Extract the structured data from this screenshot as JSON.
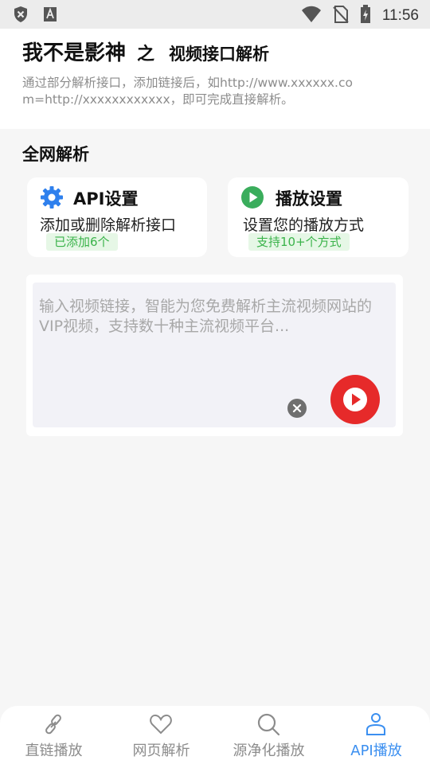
{
  "status_bar": {
    "time": "11:56",
    "icons": [
      "shield-x-icon",
      "font-a-icon",
      "wifi-icon",
      "no-sim-icon",
      "battery-charging-icon"
    ]
  },
  "header": {
    "title": "我不是影神",
    "connector": "之",
    "subtitle": "视频接口解析",
    "description": "通过部分解析接口，添加链接后，如http://www.xxxxxx.com=http://xxxxxxxxxxxx，即可完成直接解析。"
  },
  "section": {
    "title": "全网解析"
  },
  "cards": {
    "api": {
      "icon": "gear-icon",
      "title": "API设置",
      "description": "添加或删除解析接口",
      "badge": "已添加6个",
      "icon_color": "#2f80ed"
    },
    "play": {
      "icon": "play-circle-icon",
      "title": "播放设置",
      "description": "设置您的播放方式",
      "badge": "支持10+个方式",
      "icon_color": "#3aad5c"
    }
  },
  "input": {
    "placeholder": "输入视频链接，智能为您免费解析主流视频网站的VIP视频，支持数十种主流视频平台...",
    "value": "",
    "clear_icon": "close-circle-icon",
    "play_icon": "play-icon",
    "play_color": "#e62a2a"
  },
  "bottom_nav": {
    "items": [
      {
        "label": "直链播放",
        "icon": "link-icon",
        "active": false
      },
      {
        "label": "网页解析",
        "icon": "heart-icon",
        "active": false
      },
      {
        "label": "源净化播放",
        "icon": "search-icon",
        "active": false
      },
      {
        "label": "API播放",
        "icon": "user-icon",
        "active": true
      }
    ],
    "active_color": "#3b8ff0"
  }
}
